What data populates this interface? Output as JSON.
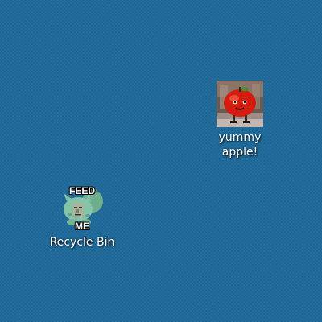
{
  "desktop": {
    "background_color": "#1e6a9a",
    "icons": [
      {
        "id": "apple",
        "label_lines": [
          "yummy",
          "apple!"
        ],
        "icon_name": "apple-picture-icon"
      },
      {
        "id": "recycle-bin",
        "label_lines": [
          "Recycle Bin"
        ],
        "icon_name": "recycle-bin-icon",
        "meme_top_text": "FEED",
        "meme_bottom_text": "ME"
      }
    ]
  }
}
